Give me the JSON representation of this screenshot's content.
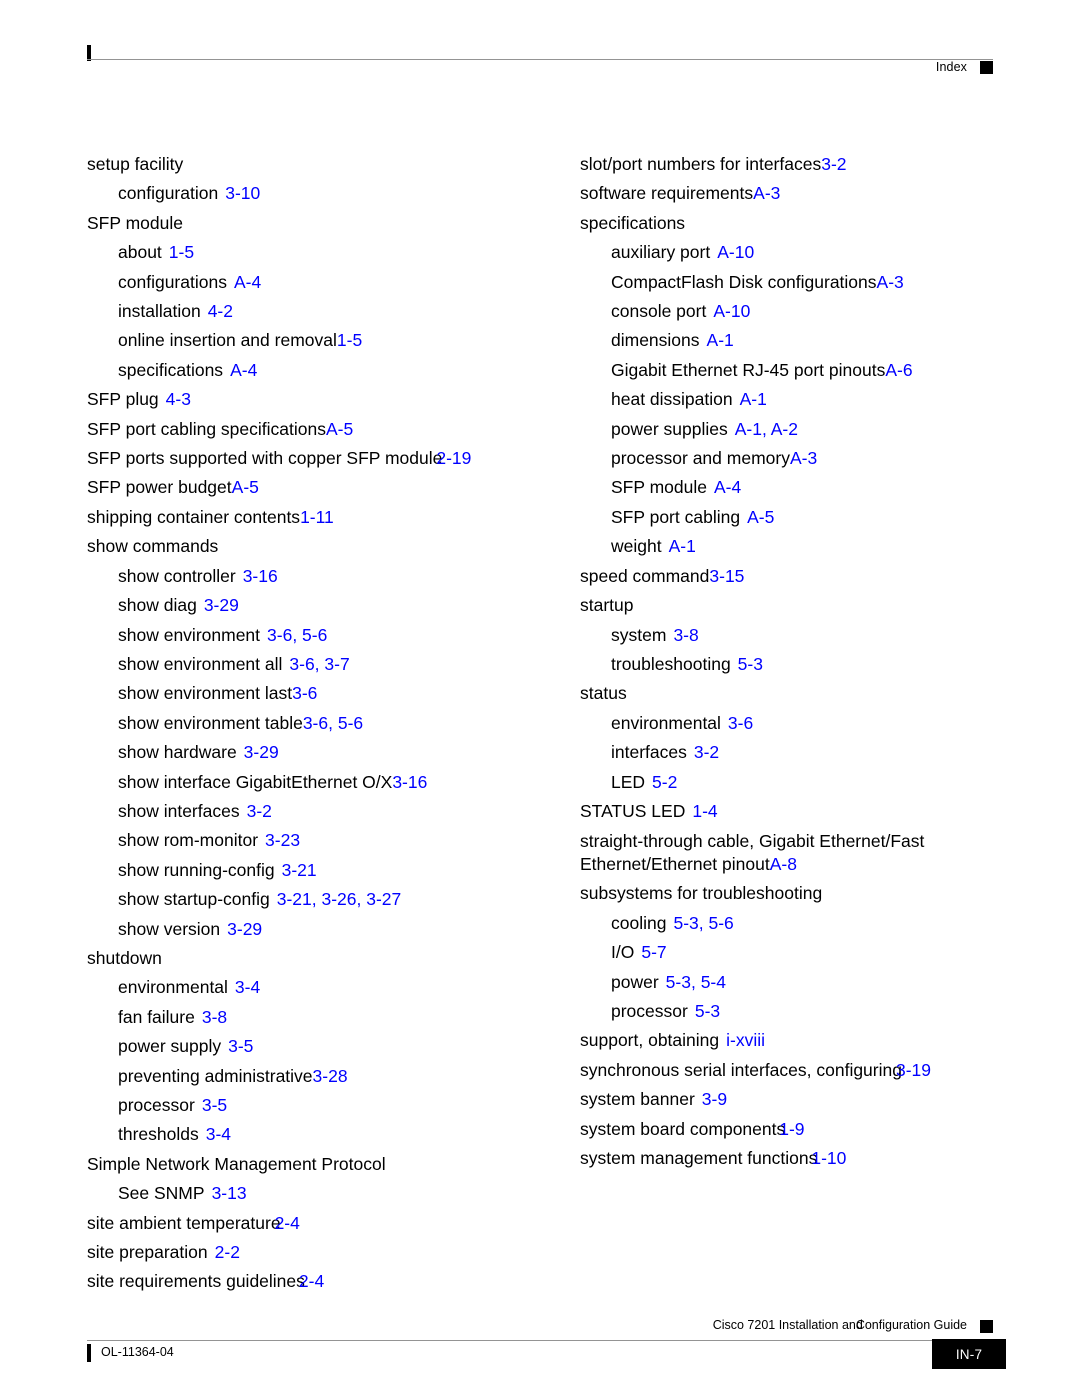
{
  "header": {
    "label": "Index",
    "marker_icon": "black-square-marker"
  },
  "footer": {
    "title_part1": "Cisco 7201 Installation and",
    "title_part2": "Configuration Guide",
    "doc_id": "OL-11364-04",
    "page_number": "IN-7",
    "marker_icon": "black-square-marker"
  },
  "index": {
    "left_column": [
      {
        "level": 1,
        "term": "setup facility",
        "refs": ""
      },
      {
        "level": 2,
        "term": "configuration",
        "refs": "3-10",
        "spacing": "normal"
      },
      {
        "level": 1,
        "term": "SFP module",
        "refs": ""
      },
      {
        "level": 2,
        "term": "about",
        "refs": "1-5",
        "spacing": "normal"
      },
      {
        "level": 2,
        "term": "configurations",
        "refs": "A-4",
        "spacing": "normal"
      },
      {
        "level": 2,
        "term": "installation",
        "refs": "4-2",
        "spacing": "normal"
      },
      {
        "level": 2,
        "term": "online insertion and removal",
        "refs": "1-5",
        "spacing": "flush"
      },
      {
        "level": 2,
        "term": "specifications",
        "refs": "A-4",
        "spacing": "normal"
      },
      {
        "level": 1,
        "term": "SFP plug",
        "refs": "4-3",
        "spacing": "normal"
      },
      {
        "level": 1,
        "term": "SFP port cabling specifications",
        "refs": "A-5",
        "spacing": "flush"
      },
      {
        "level": 1,
        "term": "SFP ports supported with copper SFP module",
        "refs": "2-19",
        "spacing": "tight"
      },
      {
        "level": 1,
        "term": "SFP power budget",
        "refs": "A-5",
        "spacing": "flush"
      },
      {
        "level": 1,
        "term": "shipping container contents",
        "refs": "1-11",
        "spacing": "flush"
      },
      {
        "level": 1,
        "term": "show commands",
        "refs": ""
      },
      {
        "level": 2,
        "term": "show controller",
        "refs": "3-16",
        "spacing": "normal"
      },
      {
        "level": 2,
        "term": "show diag",
        "refs": "3-29",
        "spacing": "normal"
      },
      {
        "level": 2,
        "term": "show environment",
        "refs": "3-6, 5-6",
        "spacing": "normal"
      },
      {
        "level": 2,
        "term": "show environment all",
        "refs": "3-6, 3-7",
        "spacing": "normal"
      },
      {
        "level": 2,
        "term": "show environment last",
        "refs": "3-6",
        "spacing": "flush"
      },
      {
        "level": 2,
        "term": "show environment table",
        "refs": "3-6, 5-6",
        "spacing": "flush"
      },
      {
        "level": 2,
        "term": "show hardware",
        "refs": "3-29",
        "spacing": "normal"
      },
      {
        "level": 2,
        "term": "show interface GigabitEthernet O/X",
        "refs": "3-16",
        "spacing": "flush"
      },
      {
        "level": 2,
        "term": "show interfaces",
        "refs": "3-2",
        "spacing": "normal"
      },
      {
        "level": 2,
        "term": "show rom-monitor",
        "refs": "3-23",
        "spacing": "normal"
      },
      {
        "level": 2,
        "term": "show running-config",
        "refs": "3-21",
        "spacing": "normal"
      },
      {
        "level": 2,
        "term": "show startup-config",
        "refs": "3-21, 3-26, 3-27",
        "spacing": "normal"
      },
      {
        "level": 2,
        "term": "show version",
        "refs": "3-29",
        "spacing": "normal"
      },
      {
        "level": 1,
        "term": "shutdown",
        "refs": ""
      },
      {
        "level": 2,
        "term": "environmental",
        "refs": "3-4",
        "spacing": "normal"
      },
      {
        "level": 2,
        "term": "fan failure",
        "refs": "3-8",
        "spacing": "normal"
      },
      {
        "level": 2,
        "term": "power supply",
        "refs": "3-5",
        "spacing": "normal"
      },
      {
        "level": 2,
        "term": "preventing administrative",
        "refs": "3-28",
        "spacing": "flush"
      },
      {
        "level": 2,
        "term": "processor",
        "refs": "3-5",
        "spacing": "normal"
      },
      {
        "level": 2,
        "term": "thresholds",
        "refs": "3-4",
        "spacing": "normal"
      },
      {
        "level": 1,
        "term": "Simple Network Management Protocol",
        "refs": ""
      },
      {
        "level": 2,
        "term": "See SNMP",
        "refs": "3-13",
        "spacing": "normal"
      },
      {
        "level": 1,
        "term": "site ambient temperature",
        "refs": "2-4",
        "spacing": "tight"
      },
      {
        "level": 1,
        "term": "site preparation",
        "refs": "2-2",
        "spacing": "normal"
      },
      {
        "level": 1,
        "term": "site requirements guidelines",
        "refs": "2-4",
        "spacing": "tight"
      }
    ],
    "right_column": [
      {
        "level": 1,
        "term": "slot/port numbers for interfaces",
        "refs": "3-2",
        "spacing": "flush"
      },
      {
        "level": 1,
        "term": "software requirements",
        "refs": "A-3",
        "spacing": "flush"
      },
      {
        "level": 1,
        "term": "specifications",
        "refs": ""
      },
      {
        "level": 2,
        "term": "auxiliary port",
        "refs": "A-10",
        "spacing": "normal"
      },
      {
        "level": 2,
        "term": "CompactFlash Disk configurations",
        "refs": "A-3",
        "spacing": "flush"
      },
      {
        "level": 2,
        "term": "console port",
        "refs": "A-10",
        "spacing": "normal"
      },
      {
        "level": 2,
        "term": "dimensions",
        "refs": "A-1",
        "spacing": "normal"
      },
      {
        "level": 2,
        "term": "Gigabit Ethernet RJ-45 port pinouts",
        "refs": "A-6",
        "spacing": "flush"
      },
      {
        "level": 2,
        "term": "heat dissipation",
        "refs": "A-1",
        "spacing": "normal"
      },
      {
        "level": 2,
        "term": "power supplies",
        "refs": "A-1, A-2",
        "spacing": "normal"
      },
      {
        "level": 2,
        "term": "processor and memory",
        "refs": "A-3",
        "spacing": "flush"
      },
      {
        "level": 2,
        "term": "SFP module",
        "refs": "A-4",
        "spacing": "normal"
      },
      {
        "level": 2,
        "term": "SFP port cabling",
        "refs": "A-5",
        "spacing": "normal"
      },
      {
        "level": 2,
        "term": "weight",
        "refs": "A-1",
        "spacing": "normal"
      },
      {
        "level": 1,
        "term": "speed command",
        "refs": "3-15",
        "spacing": "flush"
      },
      {
        "level": 1,
        "term": "startup",
        "refs": ""
      },
      {
        "level": 2,
        "term": "system",
        "refs": "3-8",
        "spacing": "normal"
      },
      {
        "level": 2,
        "term": "troubleshooting",
        "refs": "5-3",
        "spacing": "normal"
      },
      {
        "level": 1,
        "term": "status",
        "refs": ""
      },
      {
        "level": 2,
        "term": "environmental",
        "refs": "3-6",
        "spacing": "normal"
      },
      {
        "level": 2,
        "term": "interfaces",
        "refs": "3-2",
        "spacing": "normal"
      },
      {
        "level": 2,
        "term": "LED",
        "refs": "5-2",
        "spacing": "normal"
      },
      {
        "level": 1,
        "term": "STATUS LED",
        "refs": "1-4",
        "spacing": "normal"
      },
      {
        "level": 1,
        "term": "straight-through cable, Gigabit Ethernet/Fast Ethernet/Ethernet pinout",
        "refs": "A-8",
        "spacing": "flush",
        "wrap": true
      },
      {
        "level": 1,
        "term": "subsystems for troubleshooting",
        "refs": ""
      },
      {
        "level": 2,
        "term": "cooling",
        "refs": "5-3, 5-6",
        "spacing": "normal"
      },
      {
        "level": 2,
        "term": "I/O",
        "refs": "5-7",
        "spacing": "normal"
      },
      {
        "level": 2,
        "term": "power",
        "refs": "5-3, 5-4",
        "spacing": "normal"
      },
      {
        "level": 2,
        "term": "processor",
        "refs": "5-3",
        "spacing": "normal"
      },
      {
        "level": 1,
        "term": "support, obtaining",
        "refs": "i-xviii",
        "spacing": "normal"
      },
      {
        "level": 1,
        "term": "synchronous serial interfaces, configuring",
        "refs": "3-19",
        "spacing": "tight"
      },
      {
        "level": 1,
        "term": "system banner",
        "refs": "3-9",
        "spacing": "normal"
      },
      {
        "level": 1,
        "term": "system board components",
        "refs": "1-9",
        "spacing": "tight"
      },
      {
        "level": 1,
        "term": "system management functions",
        "refs": "1-10",
        "spacing": "tight"
      }
    ]
  },
  "colors": {
    "reference_link": "#0000ff",
    "text": "#000000",
    "rule": "#949494"
  }
}
